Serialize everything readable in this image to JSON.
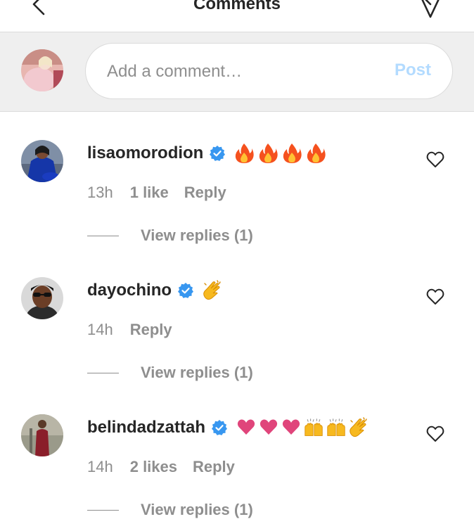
{
  "header": {
    "title": "Comments"
  },
  "composer": {
    "placeholder": "Add a comment…",
    "post_label": "Post"
  },
  "comments": [
    {
      "username": "lisaomorodion",
      "verified": true,
      "emojis": [
        "fire-emoji",
        "fire-emoji",
        "fire-emoji",
        "fire-emoji"
      ],
      "time": "13h",
      "likes": "1 like",
      "reply_label": "Reply",
      "view_replies": "View replies (1)"
    },
    {
      "username": "dayochino",
      "verified": true,
      "emojis": [
        "clapping-hands-emoji"
      ],
      "time": "14h",
      "likes": "",
      "reply_label": "Reply",
      "view_replies": "View replies (1)"
    },
    {
      "username": "belindadzattah",
      "verified": true,
      "emojis": [
        "heart-emoji",
        "heart-emoji",
        "heart-emoji",
        "raising-hands-emoji",
        "raising-hands-emoji",
        "clapping-hands-emoji"
      ],
      "time": "14h",
      "likes": "2 likes",
      "reply_label": "Reply",
      "view_replies": "View replies (1)"
    }
  ],
  "colors": {
    "text": "#262626",
    "secondary_text": "#8e8e8e",
    "post_disabled": "#b3dbff",
    "verified_blue": "#3897f0",
    "composer_bg": "#efefef",
    "border": "#dbdbdb"
  }
}
